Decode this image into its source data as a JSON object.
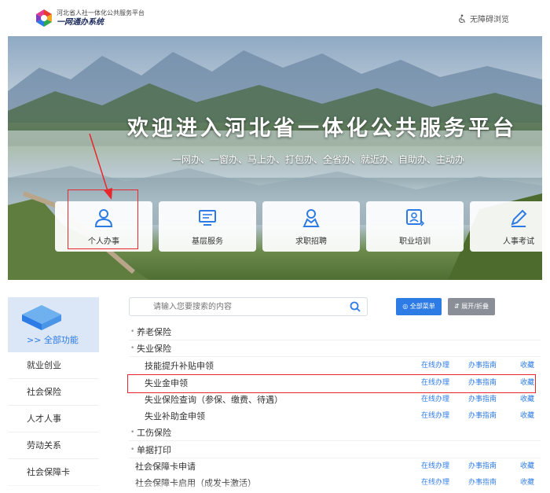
{
  "header": {
    "brand_sub": "河北省人社一体化公共服务平台",
    "brand_main": "一网通办系统",
    "accessibility": "无障碍浏览"
  },
  "banner": {
    "title": "欢迎进入河北省一体化公共服务平台",
    "subtitle": "一网办、一窗办、马上办、打包办、全省办、就近办、自助办、主动办",
    "cards": [
      {
        "label": "个人办事",
        "icon": "person-icon"
      },
      {
        "label": "基层服务",
        "icon": "monitor-icon"
      },
      {
        "label": "求职招聘",
        "icon": "badge-person-icon"
      },
      {
        "label": "职业培训",
        "icon": "training-icon"
      },
      {
        "label": "人事考试",
        "icon": "pen-icon"
      }
    ]
  },
  "sidebar": {
    "all_functions": ">> 全部功能",
    "items": [
      "就业创业",
      "社会保险",
      "人才人事",
      "劳动关系",
      "社会保障卡"
    ]
  },
  "search": {
    "placeholder": "请输入您要搜索的内容"
  },
  "toolbar": {
    "all_menu": "全部菜单",
    "expand_collapse": "展开/折叠"
  },
  "actions": {
    "online": "在线办理",
    "guide": "办事指南",
    "favorite": "收藏"
  },
  "list": [
    {
      "name": "养老保险",
      "level": 0
    },
    {
      "name": "失业保险",
      "level": 0
    },
    {
      "name": "技能提升补贴申领",
      "level": 1
    },
    {
      "name": "失业金申领",
      "level": 1
    },
    {
      "name": "失业保险查询（参保、缴费、待遇）",
      "level": 1
    },
    {
      "name": "失业补助金申领",
      "level": 1
    },
    {
      "name": "工伤保险",
      "level": 0
    },
    {
      "name": "单据打印",
      "level": 0
    },
    {
      "name": "社会保障卡申请",
      "level": 1
    },
    {
      "name": "社会保障卡启用（成发卡激活）",
      "level": 1
    }
  ],
  "colors": {
    "accent": "#2d7be5",
    "highlight": "#e8262b",
    "neutral_button": "#8a8f97"
  }
}
